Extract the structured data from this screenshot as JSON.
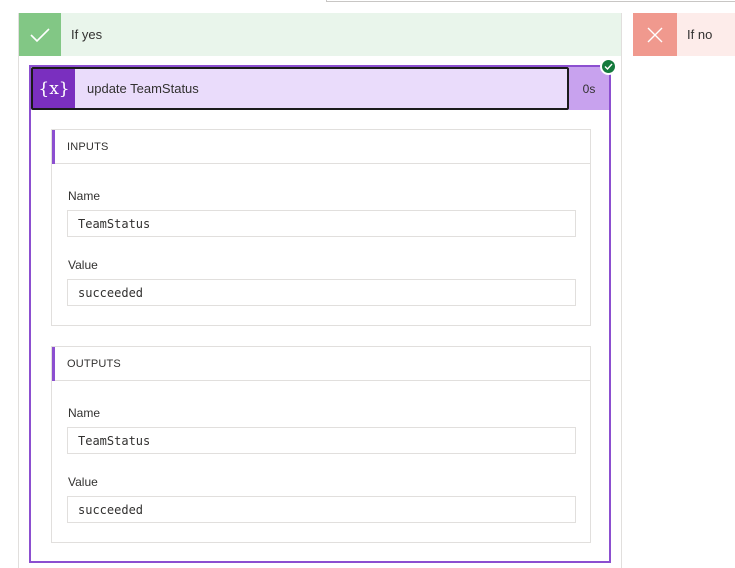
{
  "branches": {
    "yes": {
      "label": "If yes",
      "header_bg": "#e9f5eb",
      "icon_bg": "#82c785",
      "icon": "checkmark-icon"
    },
    "no": {
      "label": "If no",
      "header_bg": "#fdecea",
      "icon_bg": "#f0998e",
      "icon": "close-icon"
    }
  },
  "action": {
    "title": "update TeamStatus",
    "duration": "0s",
    "icon": "variable-icon",
    "icon_glyph": "{x}",
    "accent": "#8c4fd0",
    "status_icon": "success-check-icon",
    "status_color": "#147a3c"
  },
  "inputs": {
    "title": "INPUTS",
    "name_label": "Name",
    "name_value": "TeamStatus",
    "value_label": "Value",
    "value_value": "succeeded"
  },
  "outputs": {
    "title": "OUTPUTS",
    "name_label": "Name",
    "name_value": "TeamStatus",
    "value_label": "Value",
    "value_value": "succeeded"
  }
}
